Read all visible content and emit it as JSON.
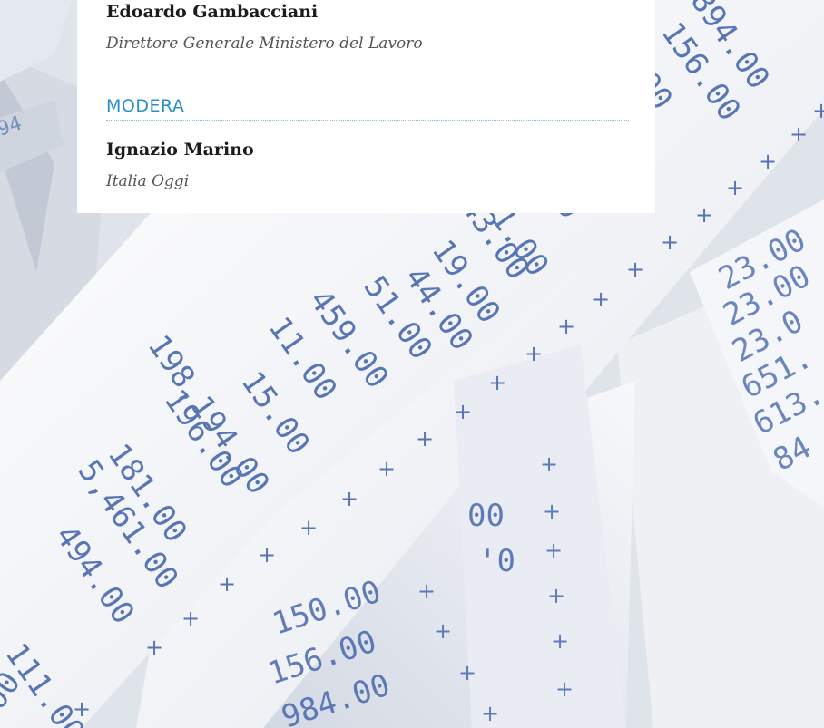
{
  "card": {
    "speaker": {
      "name": "Edoardo Gambacciani",
      "role": "Direttore Generale Ministero del Lavoro"
    },
    "section_label": "MODERA",
    "moderator": {
      "name": "Ignazio Marino",
      "role": "Italia Oggi"
    }
  },
  "background": {
    "receipt_left": [
      "94",
      "111.00",
      "494.00",
      "5,461.00",
      "181.00",
      "196.00",
      "198,194.00",
      "15.00",
      "11.00",
      "459.00",
      "51.00",
      "44.00",
      "19.00",
      "743.00",
      "1.00",
      "00",
      "00",
      "156.00",
      "894.00",
      "94.00"
    ],
    "receipt_bottom": [
      "00",
      "00",
      "0",
      "156.00",
      "984.00",
      ".00"
    ],
    "receipt_right": [
      "23.00",
      "23.00",
      "23.00",
      "651.",
      "613.",
      "84",
      "1"
    ],
    "colors": {
      "ink": "#3d5fa8",
      "paper": "#f4f5f8",
      "accent": "#2a8fc4"
    }
  }
}
